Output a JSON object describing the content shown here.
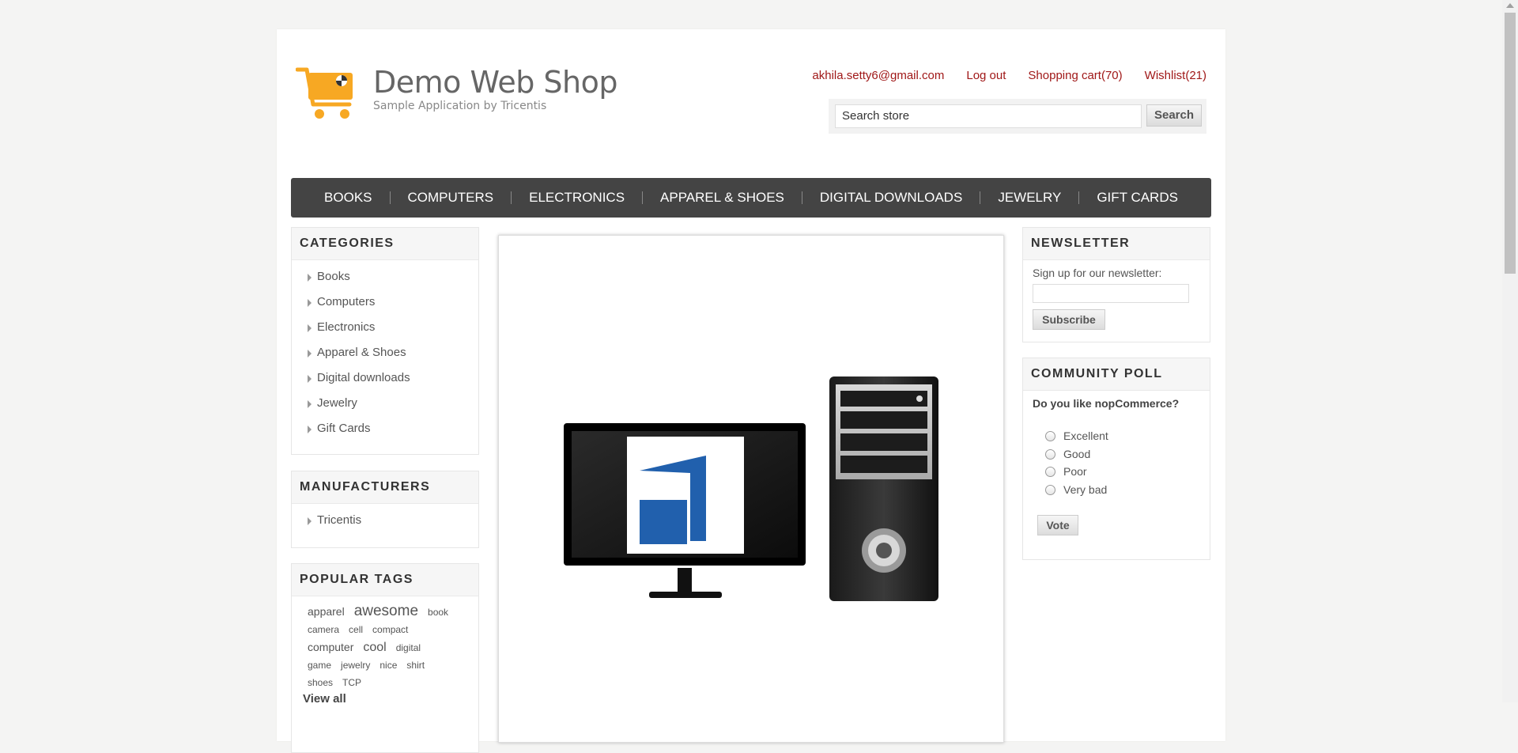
{
  "header": {
    "logo_title": "Demo Web Shop",
    "logo_subtitle": "Sample Application by Tricentis",
    "links": {
      "account": "akhila.setty6@gmail.com",
      "logout": "Log out",
      "cart": "Shopping cart(70)",
      "wishlist": "Wishlist(21)"
    },
    "search": {
      "value": "Search store",
      "button": "Search"
    }
  },
  "topmenu": [
    "BOOKS",
    "COMPUTERS",
    "ELECTRONICS",
    "APPAREL & SHOES",
    "DIGITAL DOWNLOADS",
    "JEWELRY",
    "GIFT CARDS"
  ],
  "categories": {
    "title": "CATEGORIES",
    "items": [
      "Books",
      "Computers",
      "Electronics",
      "Apparel & Shoes",
      "Digital downloads",
      "Jewelry",
      "Gift Cards"
    ]
  },
  "manufacturers": {
    "title": "MANUFACTURERS",
    "items": [
      "Tricentis"
    ]
  },
  "popular_tags": {
    "title": "POPULAR TAGS",
    "tags": [
      "apparel",
      "awesome",
      "book",
      "camera",
      "cell",
      "compact",
      "computer",
      "cool",
      "digital",
      "game",
      "jewelry",
      "nice",
      "shirt",
      "shoes",
      "TCP"
    ],
    "view_all": "View all"
  },
  "newsletter": {
    "title": "NEWSLETTER",
    "label": "Sign up for our newsletter:",
    "button": "Subscribe"
  },
  "poll": {
    "title": "COMMUNITY POLL",
    "question": "Do you like nopCommerce?",
    "options": [
      "Excellent",
      "Good",
      "Poor",
      "Very bad"
    ],
    "button": "Vote"
  },
  "colors": {
    "link": "#a01818",
    "menu_bg": "#444444",
    "logo_orange": "#f7a823",
    "brand_blue": "#2160ad"
  }
}
